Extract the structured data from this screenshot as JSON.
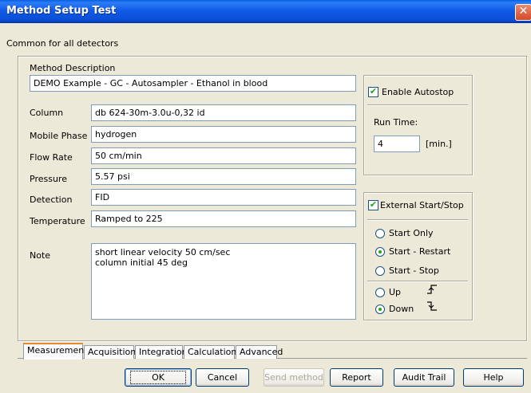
{
  "window": {
    "title": "Method Setup Test",
    "close_glyph": "✕"
  },
  "common_label": "Common for all detectors",
  "method_description": {
    "label": "Method Description",
    "value": "DEMO Example - GC - Autosampler - Ethanol in blood"
  },
  "fields": [
    {
      "label": "Column",
      "value": "db 624-30m-3.0u-0,32 id"
    },
    {
      "label": "Mobile Phase",
      "value": "hydrogen"
    },
    {
      "label": "Flow Rate",
      "value": "50 cm/min"
    },
    {
      "label": "Pressure",
      "value": "5.57 psi"
    },
    {
      "label": "Detection",
      "value": "FID"
    },
    {
      "label": "Temperature",
      "value": "Ramped to 225"
    }
  ],
  "note": {
    "label": "Note",
    "value": "short linear velocity 50 cm/sec\ncolumn initial 45 deg"
  },
  "autostop": {
    "checkbox_label": "Enable Autostop",
    "checked": true,
    "run_time_label": "Run Time:",
    "run_time_value": "4",
    "unit": "[min.]"
  },
  "external": {
    "checkbox_label": "External Start/Stop",
    "checked": true,
    "mode_options": [
      "Start Only",
      "Start - Restart",
      "Start - Stop"
    ],
    "mode_selected": "Start - Restart",
    "edge_options": [
      "Up",
      "Down"
    ],
    "edge_selected": "Down",
    "up_icon": "rising-edge-icon",
    "down_icon": "falling-edge-icon"
  },
  "tabs": [
    "Measurement",
    "Acquisition",
    "Integration",
    "Calculation",
    "Advanced"
  ],
  "active_tab": "Measurement",
  "buttons": {
    "ok": "OK",
    "cancel": "Cancel",
    "send_method": "Send method",
    "report": "Report",
    "audit_trail": "Audit Trail",
    "help": "Help"
  },
  "colors": {
    "title_bar": "#0b55e0",
    "dialog_bg": "#ece9d8",
    "tab_highlight": "#e68b2c"
  }
}
